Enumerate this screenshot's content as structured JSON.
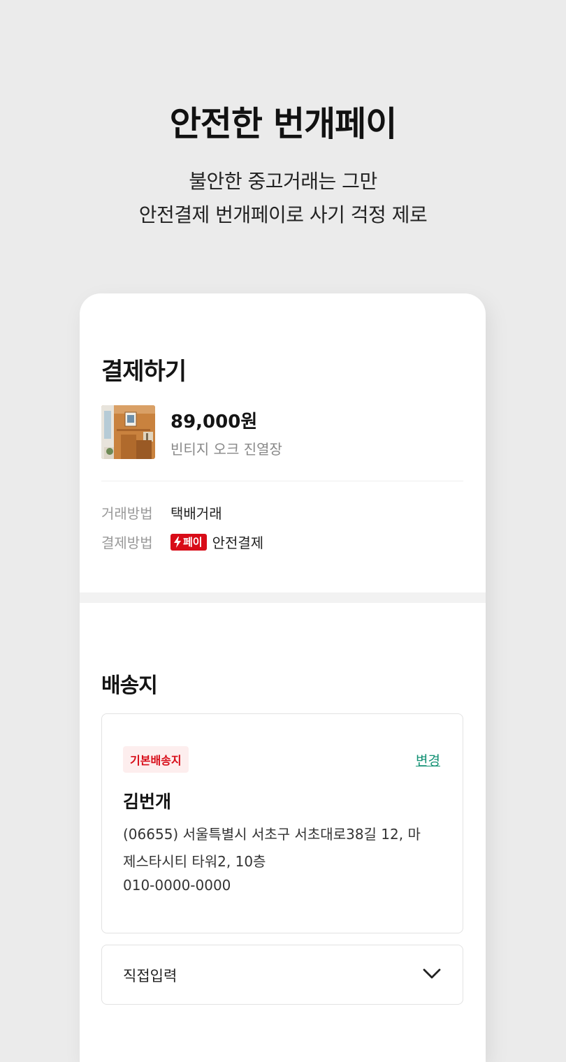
{
  "hero": {
    "title": "안전한 번개페이",
    "subtitle_line1": "불안한 중고거래는 그만",
    "subtitle_line2": "안전결제 번개페이로 사기 걱정 제로"
  },
  "payment": {
    "title": "결제하기",
    "price": "89,000원",
    "item_name": "빈티지 오크 진열장",
    "method_label": "거래방법",
    "method_value": "택배거래",
    "pay_label": "결제방법",
    "pay_badge": "페이",
    "pay_value": "안전결제",
    "brand_color": "#d80c18"
  },
  "shipping": {
    "title": "배송지",
    "default_badge": "기본배송지",
    "change_label": "변경",
    "recipient": "김번개",
    "address_line1": "(06655) 서울특별시 서초구 서초대로38길 12, 마",
    "address_line2": "제스타시티 타워2, 10층",
    "phone": "010-0000-0000",
    "direct_input": "직접입력",
    "icons": [
      "lightning-icon",
      "chevron-down-icon"
    ]
  }
}
